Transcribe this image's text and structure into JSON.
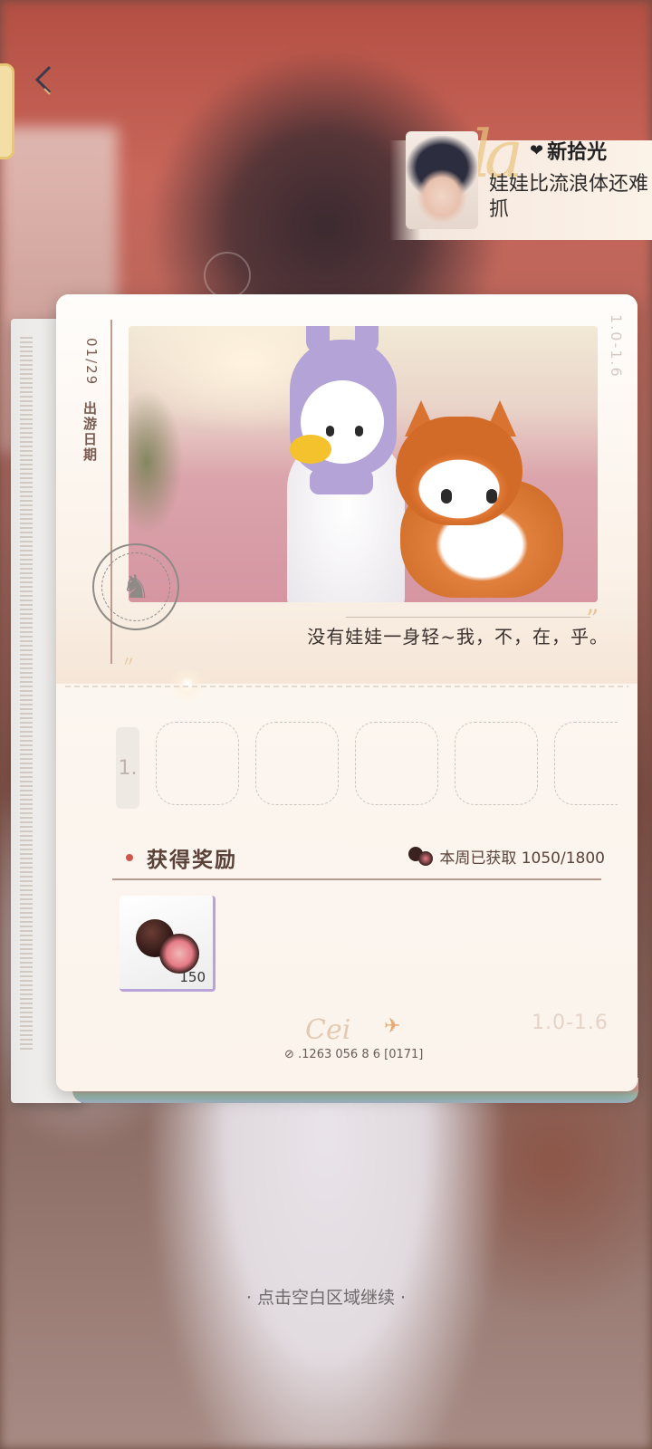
{
  "character": {
    "name": "新拾光",
    "line": "娃娃比流浪体还难抓"
  },
  "journal": {
    "date": "01/29",
    "date_label": "出游日期",
    "side_code": "1.0-1.6",
    "quote": "没有娃娃一身轻~我，不，在，乎。",
    "slot_tab_glyph": "1.",
    "rewards": {
      "title": "获得奖励",
      "weekly_text": "本周已获取 1050/1800",
      "items": [
        {
          "icon": "chocolate-icon",
          "qty": "150"
        }
      ]
    },
    "footer_serial": ".1263 056  8 6  [0171]",
    "version": "1.0-1.6"
  },
  "hint": "· 点击空白区域继续 ·",
  "colors": {
    "accent_red": "#d0574d",
    "card_bg": "#fcf6f0",
    "item_border": "#b8a2d9"
  }
}
